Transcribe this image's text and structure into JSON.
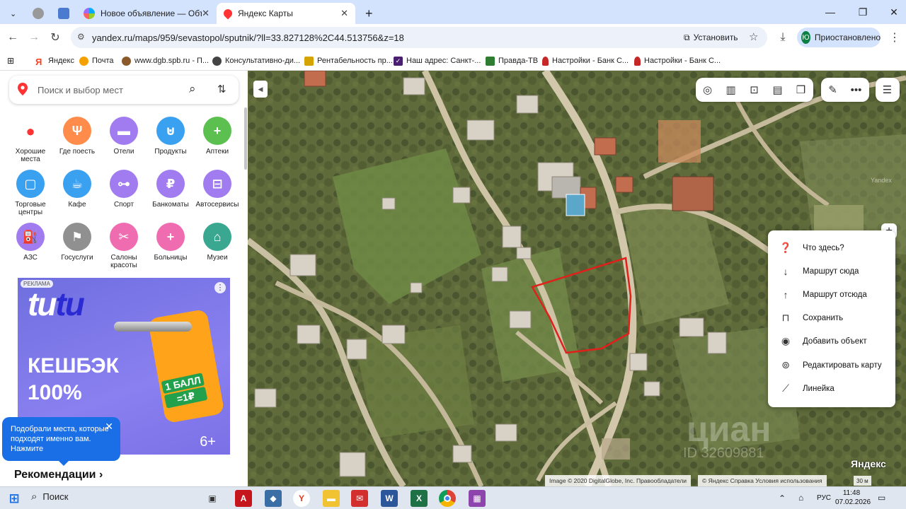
{
  "browser": {
    "tabs": [
      {
        "title": "",
        "active": false
      },
      {
        "title": "",
        "active": false
      },
      {
        "title": "Новое объявление — Объявл",
        "active": false
      },
      {
        "title": "Яндекс Карты",
        "active": true
      }
    ],
    "new_tab_label": "+",
    "url": "yandex.ru/maps/959/sevastopol/sputnik/?ll=33.827128%2C44.513756&z=18",
    "install_label": "Установить",
    "profile": {
      "initial": "Ю",
      "status": "Приостановлено"
    },
    "bookmarks": [
      {
        "label": "Яндекс",
        "color": "#fc3f1d"
      },
      {
        "label": "Почта",
        "color": "#f4a100"
      },
      {
        "label": "www.dgb.spb.ru - П...",
        "color": "#8a5a2b"
      },
      {
        "label": "Консультативно-ди...",
        "color": "#444444"
      },
      {
        "label": "Рентабельность пр...",
        "color": "#d6a400"
      },
      {
        "label": "Наш адрес: Санкт-...",
        "color": "#4b1f6f"
      },
      {
        "label": "Правда-ТВ",
        "color": "#2e7d32"
      },
      {
        "label": "Настройки - Банк С...",
        "color": "#c62828"
      },
      {
        "label": "Настройки - Банк С...",
        "color": "#c62828"
      }
    ]
  },
  "sidebar": {
    "search_placeholder": "Поиск и выбор мест",
    "categories": [
      {
        "label": "Хорошие места",
        "color": "#ffffff",
        "icon": "laurel-pin-icon"
      },
      {
        "label": "Где поесть",
        "color": "#ff8c4a",
        "icon": "fork-knife-icon"
      },
      {
        "label": "Отели",
        "color": "#a07cf0",
        "icon": "bed-icon"
      },
      {
        "label": "Продукты",
        "color": "#3aa0f0",
        "icon": "basket-icon"
      },
      {
        "label": "Аптеки",
        "color": "#5cc050",
        "icon": "plus-icon"
      },
      {
        "label": "Торговые центры",
        "color": "#3aa0f0",
        "icon": "bag-icon"
      },
      {
        "label": "Кафе",
        "color": "#3aa0f0",
        "icon": "cup-icon"
      },
      {
        "label": "Спорт",
        "color": "#a07cf0",
        "icon": "dumbbell-icon"
      },
      {
        "label": "Банкоматы",
        "color": "#a07cf0",
        "icon": "ruble-icon"
      },
      {
        "label": "Автосервисы",
        "color": "#a07cf0",
        "icon": "car-icon"
      },
      {
        "label": "АЗС",
        "color": "#a07cf0",
        "icon": "fuel-icon"
      },
      {
        "label": "Госуслуги",
        "color": "#909090",
        "icon": "flag-icon"
      },
      {
        "label": "Салоны красоты",
        "color": "#f06cb0",
        "icon": "scissors-icon"
      },
      {
        "label": "Больницы",
        "color": "#f06cb0",
        "icon": "plus-icon"
      },
      {
        "label": "Музеи",
        "color": "#3aa890",
        "icon": "museum-icon"
      }
    ],
    "ad": {
      "label": "РЕКЛАМА",
      "logo_a": "tu",
      "logo_b": "tu",
      "cashback": "КЕШБЭК",
      "percent": "100%",
      "tag_line1": "1 БАЛЛ",
      "tag_line2": "=1₽",
      "age": "6+"
    },
    "toast": "Подобрали места, которые подходят именно вам. Нажмите",
    "recommendations": "Рекомендации ›"
  },
  "map": {
    "context_menu": [
      {
        "label": "Что здесь?",
        "icon": "question-icon"
      },
      {
        "label": "Маршрут сюда",
        "icon": "arrow-down-icon"
      },
      {
        "label": "Маршрут отсюда",
        "icon": "arrow-up-icon"
      },
      {
        "label": "Сохранить",
        "icon": "bookmark-icon"
      },
      {
        "label": "Добавить объект",
        "icon": "add-place-icon"
      },
      {
        "label": "Редактировать карту",
        "icon": "edit-map-icon"
      },
      {
        "label": "Линейка",
        "icon": "ruler-icon"
      }
    ],
    "attribution": "Image © 2020 DigitalGlobe, Inc.   Правообладатели",
    "attribution2": "© Яндекс   Справка   Условия использования",
    "logo": "Яндекс",
    "scale": "30 м",
    "watermark": "циан",
    "watermark_phone": "ID 32609881",
    "corner_brand": "Yandex",
    "highlight_color": "#e0201a"
  },
  "taskbar": {
    "search": "Поиск",
    "lang": "РУС",
    "time": "11:48",
    "date": "07.02.2026"
  }
}
